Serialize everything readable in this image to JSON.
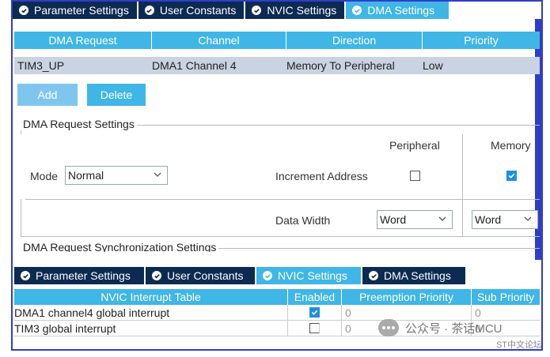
{
  "top_tabs": [
    {
      "label": "Parameter Settings",
      "active": false
    },
    {
      "label": "User Constants",
      "active": false
    },
    {
      "label": "NVIC Settings",
      "active": false
    },
    {
      "label": "DMA Settings",
      "active": true
    }
  ],
  "dma_table": {
    "headers": [
      "DMA Request",
      "Channel",
      "Direction",
      "Priority"
    ],
    "row": [
      "TIM3_UP",
      "DMA1 Channel 4",
      "Memory To Peripheral",
      "Low"
    ]
  },
  "buttons": {
    "add": "Add",
    "delete": "Delete"
  },
  "dma_request_settings": {
    "legend": "DMA Request Settings",
    "peripheral_label": "Peripheral",
    "memory_label": "Memory",
    "mode_label": "Mode",
    "mode_value": "Normal",
    "increment_label": "Increment Address",
    "peripheral_increment": false,
    "memory_increment": true,
    "data_width_label": "Data Width",
    "peripheral_width": "Word",
    "memory_width": "Word"
  },
  "sync_settings_legend": "DMA Request Synchronization Settings",
  "bottom_tabs": [
    {
      "label": "Parameter Settings",
      "active": false
    },
    {
      "label": "User Constants",
      "active": false
    },
    {
      "label": "NVIC Settings",
      "active": true
    },
    {
      "label": "DMA Settings",
      "active": false
    }
  ],
  "nvic_table": {
    "headers": [
      "NVIC Interrupt Table",
      "Enabled",
      "Preemption Priority",
      "Sub Priority"
    ],
    "rows": [
      {
        "name": "DMA1 channel4 global interrupt",
        "enabled": true,
        "preemption": "0",
        "sub": "0"
      },
      {
        "name": "TIM3 global interrupt",
        "enabled": false,
        "preemption": "0",
        "sub": "0"
      }
    ]
  },
  "watermark": {
    "text": "公众号 · 茶话MCU",
    "sub": "ST中文论坛"
  },
  "colors": {
    "tab_dark": "#0c2a52",
    "accent": "#3fb6e6",
    "frame": "#2f3ec9",
    "checkbox": "#1e90e0"
  }
}
